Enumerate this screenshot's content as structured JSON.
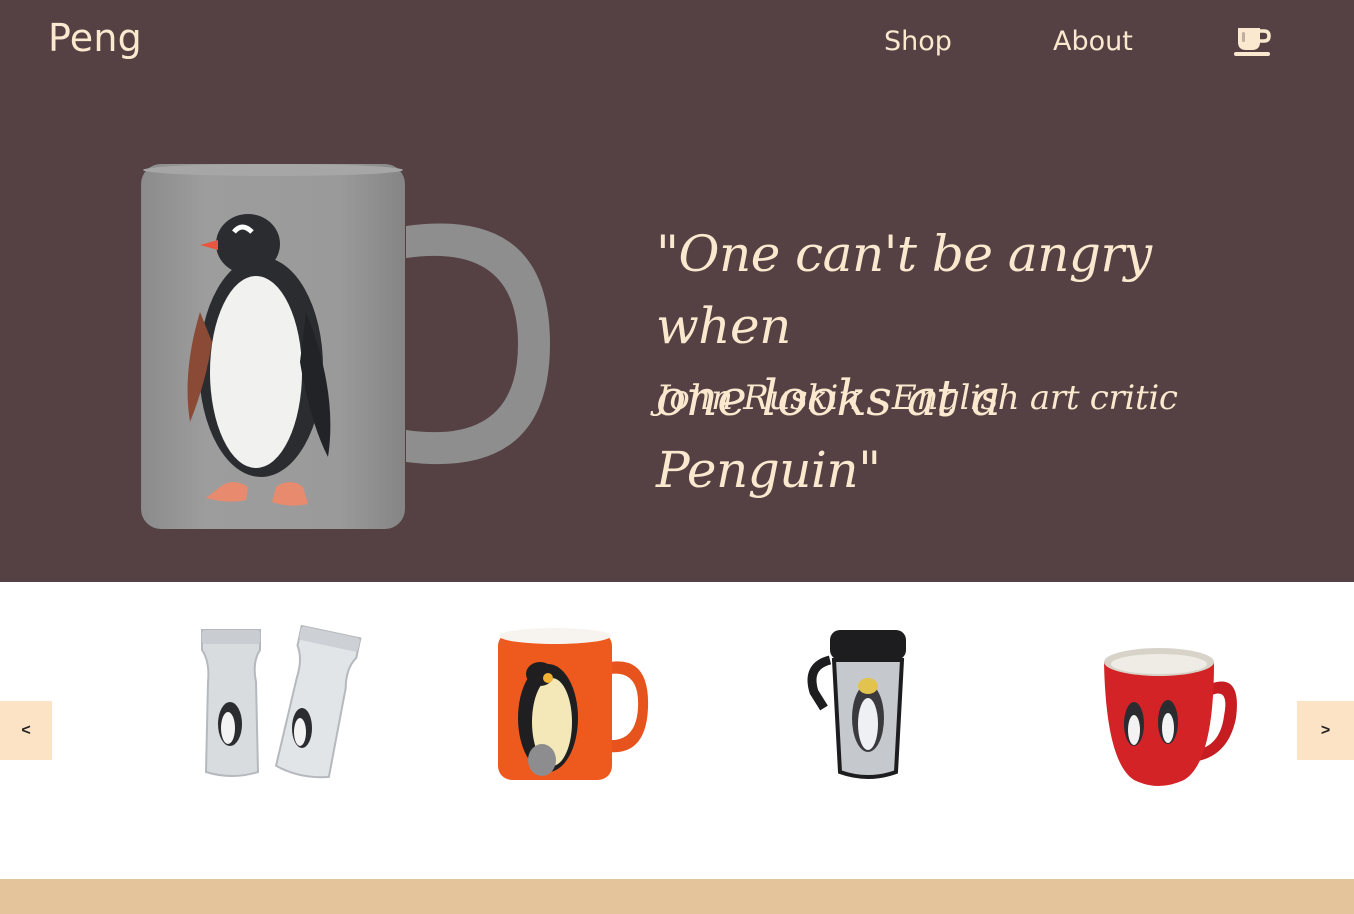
{
  "brand": {
    "name": "Peng"
  },
  "nav": {
    "shop_label": "Shop",
    "about_label": "About",
    "cart_icon": "coffee-cup-icon"
  },
  "hero": {
    "image": "penguin-mug-image",
    "quote_line1": "\"One can't be angry when",
    "quote_line2": "one looks at a Penguin\"",
    "attribution": "John Ruskin - English art critic"
  },
  "carousel": {
    "prev_label": "<",
    "next_label": ">",
    "products": [
      {
        "image": "penguin-travel-tumblers-image"
      },
      {
        "image": "orange-emperor-penguin-mug-image"
      },
      {
        "image": "steel-penguin-travel-mug-image"
      },
      {
        "image": "red-penguin-mug-image"
      }
    ]
  },
  "colors": {
    "hero_background": "#554143",
    "text_cream": "#fbe9cf",
    "arrow_background": "#fde3c6",
    "footer_strip": "#e4c59b",
    "carousel_background": "#ffffff"
  }
}
